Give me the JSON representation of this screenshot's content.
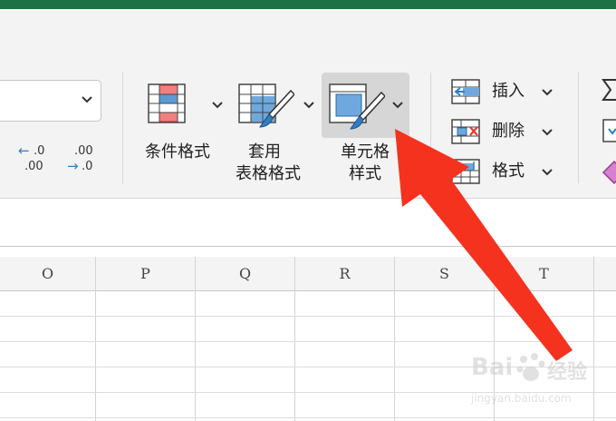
{
  "ribbon": {
    "number_group": {
      "format_dropdown_value": "",
      "increase_decimal": {
        "top": ".0",
        "bottom": ".00"
      },
      "decrease_decimal": {
        "top": ".00",
        "bottom": ".0"
      }
    },
    "styles_group": {
      "conditional_formatting": "条件格式",
      "format_as_table_line1": "套用",
      "format_as_table_line2": "表格格式",
      "cell_styles_line1": "单元格",
      "cell_styles_line2": "样式"
    },
    "cells_group": {
      "insert": "插入",
      "delete": "删除",
      "format": "格式"
    }
  },
  "grid": {
    "columns": [
      "O",
      "P",
      "Q",
      "R",
      "S",
      "T"
    ]
  },
  "annotation": {
    "arrow_color": "#f5321e"
  },
  "watermark": {
    "brand": "Bai",
    "brand2": "经验",
    "url": "jingyan.baidu.com"
  },
  "colors": {
    "title_bar": "#1e7145",
    "accent_blue": "#2f7ec6",
    "highlight_red": "#f08080"
  }
}
